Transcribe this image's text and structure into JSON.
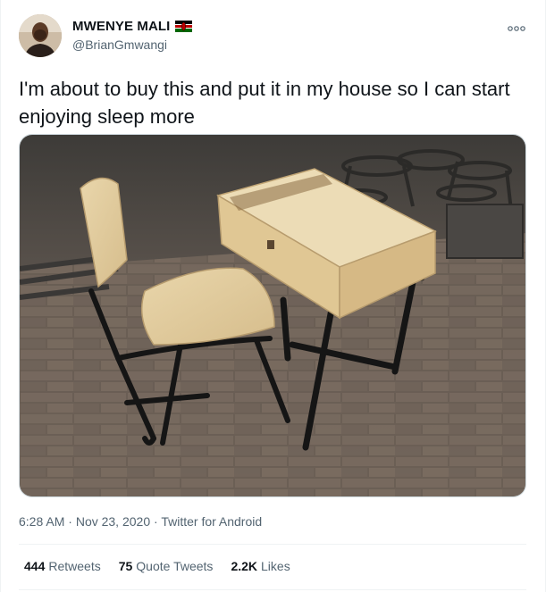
{
  "user": {
    "display_name": "MWENYE MALI",
    "handle": "@BrianGmwangi",
    "flag": "kenya-flag-icon"
  },
  "tweet": {
    "text": "I'm about to buy this and put it in my house so I can start enjoying sleep more",
    "image_icon": "school-desk-and-chair-photo"
  },
  "meta": {
    "time": "6:28 AM",
    "separator": "·",
    "date": "Nov 23, 2020",
    "source": "Twitter for Android"
  },
  "stats": {
    "retweets_count": "444",
    "retweets_label": "Retweets",
    "quotes_count": "75",
    "quotes_label": "Quote Tweets",
    "likes_count": "2.2K",
    "likes_label": "Likes"
  },
  "colors": {
    "text_primary": "#0f1419",
    "text_secondary": "#536471",
    "divider": "#eff3f4"
  }
}
